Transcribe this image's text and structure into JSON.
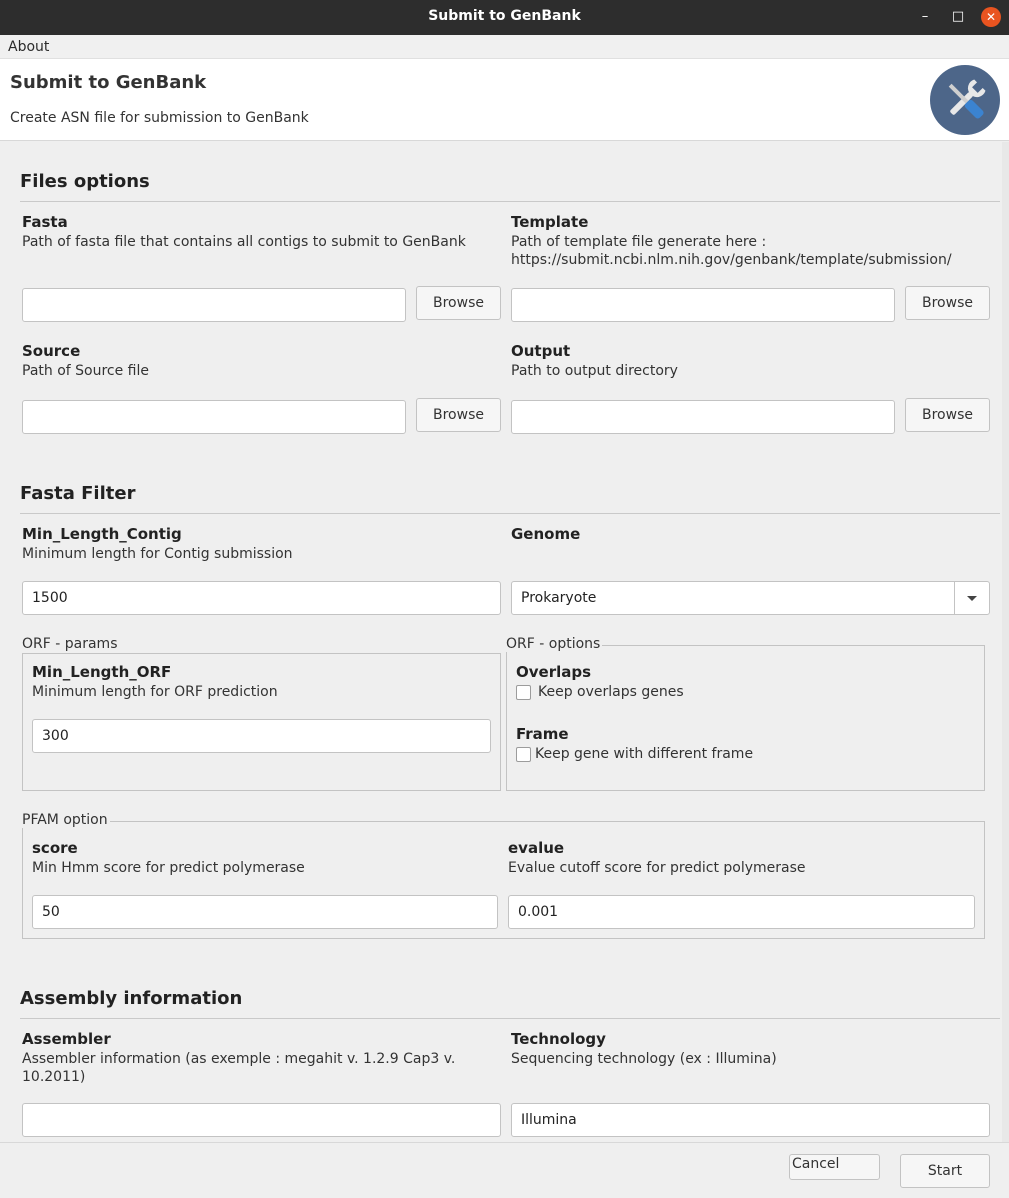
{
  "window": {
    "title": "Submit to GenBank",
    "minimize_glyph": "–",
    "maximize_glyph": "□",
    "close_glyph": "✕"
  },
  "menu": {
    "about": "About"
  },
  "header": {
    "title": "Submit to GenBank",
    "subtitle": "Create ASN file for submission to GenBank",
    "icon": "tools-icon"
  },
  "files_options": {
    "heading": "Files options",
    "fasta": {
      "label": "Fasta",
      "desc": "Path of fasta file that contains all contigs to submit to GenBank",
      "value": "",
      "browse": "Browse"
    },
    "template": {
      "label": "Template",
      "desc": "Path of template file generate here : https://submit.ncbi.nlm.nih.gov/genbank/template/submission/",
      "value": "",
      "browse": "Browse"
    },
    "source": {
      "label": "Source",
      "desc": "Path of Source file",
      "value": "",
      "browse": "Browse"
    },
    "output": {
      "label": "Output",
      "desc": "Path to output directory",
      "value": "",
      "browse": "Browse"
    }
  },
  "fasta_filter": {
    "heading": "Fasta Filter",
    "min_length_contig": {
      "label": "Min_Length_Contig",
      "desc": "Minimum length for Contig submission",
      "value": "1500"
    },
    "genome": {
      "label": "Genome",
      "value": "Prokaryote"
    },
    "orf_params": {
      "title": "ORF - params",
      "min_length_orf": {
        "label": "Min_Length_ORF",
        "desc": "Minimum length for ORF prediction",
        "value": "300"
      }
    },
    "orf_options": {
      "title": "ORF - options",
      "overlaps": {
        "label": "Overlaps",
        "checkbox": "Keep overlaps genes",
        "checked": false
      },
      "frame": {
        "label": "Frame",
        "checkbox": "Keep gene with different frame",
        "checked": false
      }
    },
    "pfam": {
      "title": "PFAM option",
      "score": {
        "label": "score",
        "desc": "Min Hmm score for predict polymerase",
        "value": "50"
      },
      "evalue": {
        "label": "evalue",
        "desc": "Evalue cutoff score for predict polymerase",
        "value": "0.001"
      }
    }
  },
  "assembly": {
    "heading": "Assembly information",
    "assembler": {
      "label": "Assembler",
      "desc": "Assembler information (as exemple : megahit v. 1.2.9  Cap3 v. 10.2011)",
      "value": ""
    },
    "technology": {
      "label": "Technology",
      "desc": "Sequencing technology (ex : Illumina)",
      "value": "Illumina"
    }
  },
  "footer": {
    "cancel": "Cancel",
    "start": "Start"
  }
}
